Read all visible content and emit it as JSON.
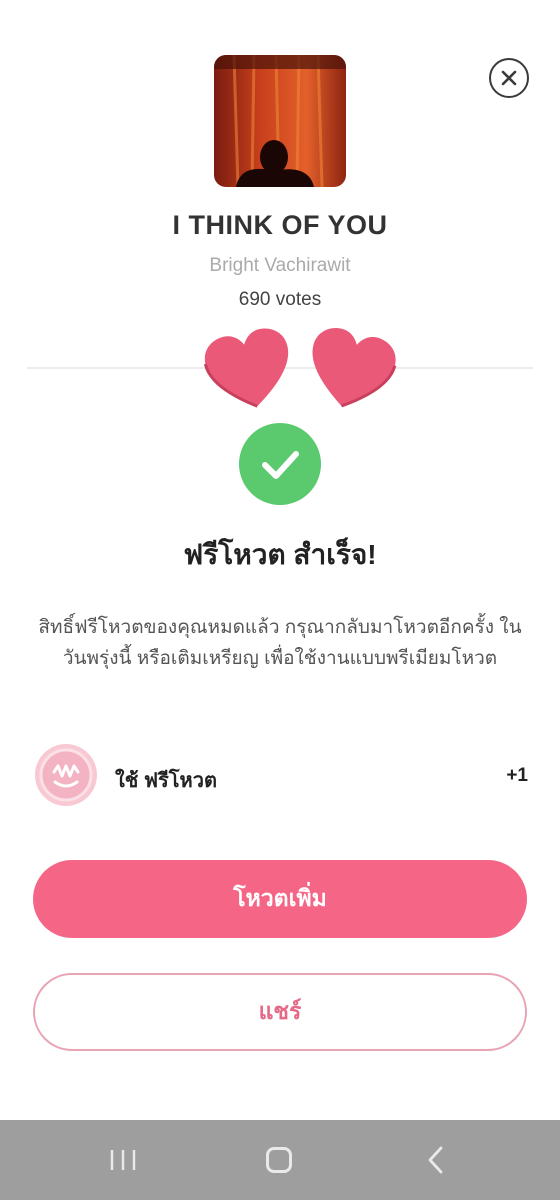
{
  "song": {
    "title": "I THINK OF YOU",
    "artist": "Bright Vachirawit",
    "votes": "690 votes"
  },
  "result": {
    "title": "ฟรีโหวต สำเร็จ!",
    "message": "สิทธิ์ฟรีโหวตของคุณหมดแล้ว กรุณากลับมาโหวตอีกครั้ง ในวันพรุ่งนี้ หรือเติมเหรียญ เพื่อใช้งานแบบพรีเมียมโหวต"
  },
  "usage": {
    "label": "ใช้ ฟรีโหวต",
    "count": "+1"
  },
  "buttons": {
    "vote_more": "โหวตเพิ่ม",
    "share": "แชร์"
  },
  "colors": {
    "accent": "#f56686",
    "success": "#5bc96e",
    "heart": "#ea5a78"
  },
  "icons": {
    "close": "close-icon",
    "success": "check-icon",
    "coin": "coin-icon"
  }
}
